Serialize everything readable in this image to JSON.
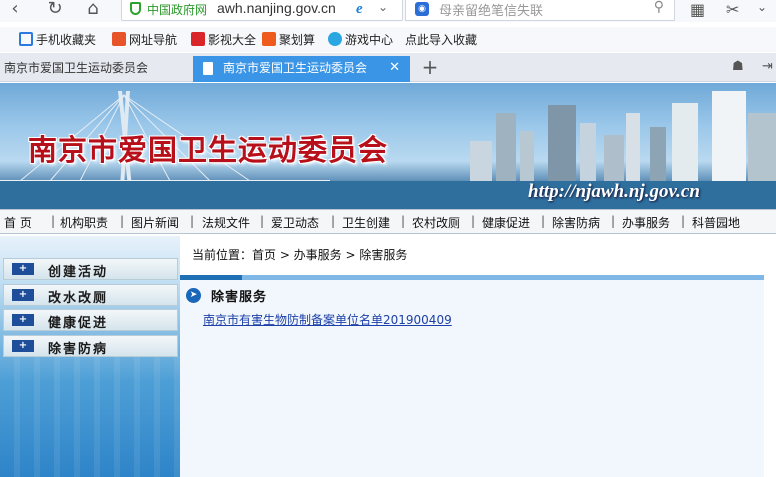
{
  "browser": {
    "address": {
      "badge": "中国政府网",
      "url": "awh.nanjing.gov.cn",
      "engine_icon": "e"
    },
    "search": {
      "placeholder": "母亲留绝笔信失联"
    },
    "bookmarks": [
      {
        "label": "手机收藏夹",
        "icon": "bookmark-icon",
        "color": "#2a7ae2"
      },
      {
        "label": "网址导航",
        "icon": "nav-icon",
        "color": "#e8542a"
      },
      {
        "label": "影视大全",
        "icon": "video-icon",
        "color": "#d8262b"
      },
      {
        "label": "聚划算",
        "icon": "juhuasuan-icon",
        "color": "#ef5a1e"
      },
      {
        "label": "游戏中心",
        "icon": "game-icon",
        "color": "#2aa7e2"
      },
      {
        "label": "点此导入收藏",
        "icon": "",
        "color": ""
      }
    ],
    "tabs": [
      {
        "label": "南京市爱国卫生运动委员会",
        "active": false
      },
      {
        "label": "南京市爱国卫生运动委员会",
        "active": true
      }
    ]
  },
  "site": {
    "banner_title": "南京市爱国卫生运动委员会",
    "banner_url": "http://njawh.nj.gov.cn",
    "nav": [
      "首  页",
      "机构职责",
      "图片新闻",
      "法规文件",
      "爱卫动态",
      "卫生创建",
      "农村改厕",
      "健康促进",
      "除害防病",
      "办事服务",
      "科普园地"
    ],
    "sidebar": [
      {
        "label": "创建活动"
      },
      {
        "label": "改水改厕"
      },
      {
        "label": "健康促进"
      },
      {
        "label": "除害防病"
      }
    ],
    "breadcrumb": "当前位置：首页 > 办事服务 > 除害服务",
    "section_title": "除害服务",
    "documents": [
      {
        "title": "南京市有害生物防制备案单位名单201900409"
      }
    ]
  },
  "colors": {
    "accent_tab": "#3b95e6",
    "banner_title": "#b8101a",
    "link": "#1c3fa8",
    "section_bar": "#1f6fb5"
  }
}
